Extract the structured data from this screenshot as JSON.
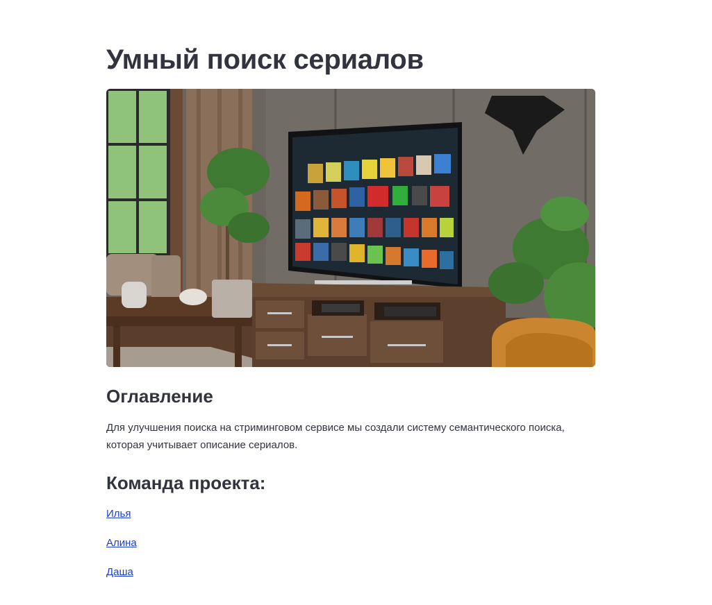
{
  "page": {
    "title": "Умный поиск сериалов"
  },
  "toc": {
    "heading": "Оглавление",
    "description": "Для улучшения поиска на стриминговом сервисе мы создали систему семантического поиска, которая учитывает описание сериалов."
  },
  "team": {
    "heading": "Команда проекта:",
    "members": [
      "Илья",
      "Алина",
      "Даша"
    ]
  },
  "colors": {
    "text": "#31333f",
    "link": "#1c3fd1",
    "background": "#ffffff"
  }
}
